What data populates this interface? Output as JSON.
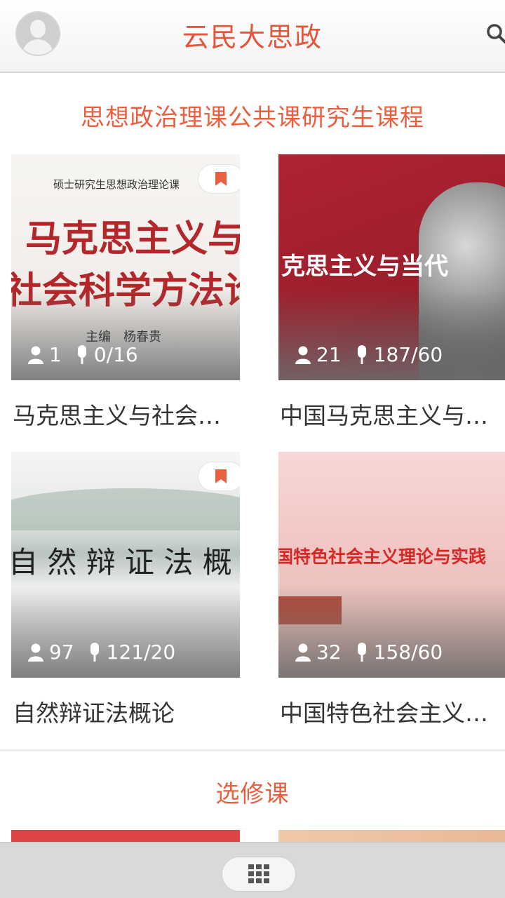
{
  "header": {
    "title": "云民大思政"
  },
  "sections": [
    {
      "title": "思想政治理课公共课研究生课程",
      "courses": [
        {
          "title": "马克思主义与社会…",
          "learners": "1",
          "lessons": "0/16",
          "bookmarked": true,
          "cover_top_line": "硕士研究生思想政治理论课",
          "cover_line1": "马克思主义与",
          "cover_line2": "社会科学方法论",
          "cover_editor": "主编　杨春贵"
        },
        {
          "title": "中国马克思主义与…",
          "learners": "21",
          "lessons": "187/60",
          "bookmarked": false,
          "cover_line1": "克思主义与当代"
        },
        {
          "title": "自然辩证法概论",
          "learners": "97",
          "lessons": "121/20",
          "bookmarked": true,
          "cover_line1": "自 然 辩 证 法 概"
        },
        {
          "title": "中国特色社会主义…",
          "learners": "32",
          "lessons": "158/60",
          "bookmarked": false,
          "cover_line1": "国特色社会主义理论与实践"
        }
      ]
    },
    {
      "title": "选修课"
    }
  ],
  "icons": {
    "user": "user-icon",
    "mic": "microphone-icon",
    "bookmark": "bookmark-icon",
    "search": "search-icon",
    "menu": "grid-menu-icon"
  },
  "colors": {
    "accent": "#e4553a",
    "bookmark": "#e8603f"
  }
}
